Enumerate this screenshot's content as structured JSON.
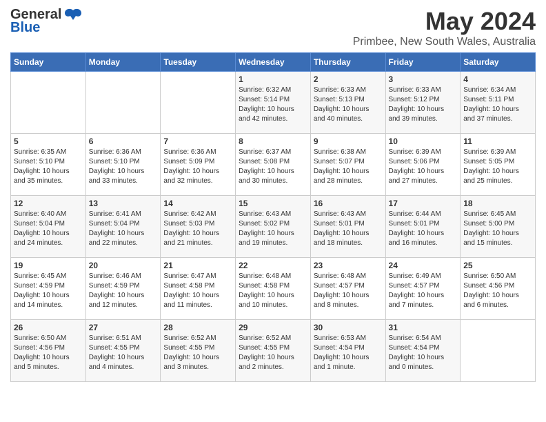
{
  "logo": {
    "general": "General",
    "blue": "Blue"
  },
  "title": "May 2024",
  "location": "Primbee, New South Wales, Australia",
  "days_of_week": [
    "Sunday",
    "Monday",
    "Tuesday",
    "Wednesday",
    "Thursday",
    "Friday",
    "Saturday"
  ],
  "weeks": [
    [
      {
        "day": "",
        "sunrise": "",
        "sunset": "",
        "daylight": ""
      },
      {
        "day": "",
        "sunrise": "",
        "sunset": "",
        "daylight": ""
      },
      {
        "day": "",
        "sunrise": "",
        "sunset": "",
        "daylight": ""
      },
      {
        "day": "1",
        "sunrise": "Sunrise: 6:32 AM",
        "sunset": "Sunset: 5:14 PM",
        "daylight": "Daylight: 10 hours and 42 minutes."
      },
      {
        "day": "2",
        "sunrise": "Sunrise: 6:33 AM",
        "sunset": "Sunset: 5:13 PM",
        "daylight": "Daylight: 10 hours and 40 minutes."
      },
      {
        "day": "3",
        "sunrise": "Sunrise: 6:33 AM",
        "sunset": "Sunset: 5:12 PM",
        "daylight": "Daylight: 10 hours and 39 minutes."
      },
      {
        "day": "4",
        "sunrise": "Sunrise: 6:34 AM",
        "sunset": "Sunset: 5:11 PM",
        "daylight": "Daylight: 10 hours and 37 minutes."
      }
    ],
    [
      {
        "day": "5",
        "sunrise": "Sunrise: 6:35 AM",
        "sunset": "Sunset: 5:10 PM",
        "daylight": "Daylight: 10 hours and 35 minutes."
      },
      {
        "day": "6",
        "sunrise": "Sunrise: 6:36 AM",
        "sunset": "Sunset: 5:10 PM",
        "daylight": "Daylight: 10 hours and 33 minutes."
      },
      {
        "day": "7",
        "sunrise": "Sunrise: 6:36 AM",
        "sunset": "Sunset: 5:09 PM",
        "daylight": "Daylight: 10 hours and 32 minutes."
      },
      {
        "day": "8",
        "sunrise": "Sunrise: 6:37 AM",
        "sunset": "Sunset: 5:08 PM",
        "daylight": "Daylight: 10 hours and 30 minutes."
      },
      {
        "day": "9",
        "sunrise": "Sunrise: 6:38 AM",
        "sunset": "Sunset: 5:07 PM",
        "daylight": "Daylight: 10 hours and 28 minutes."
      },
      {
        "day": "10",
        "sunrise": "Sunrise: 6:39 AM",
        "sunset": "Sunset: 5:06 PM",
        "daylight": "Daylight: 10 hours and 27 minutes."
      },
      {
        "day": "11",
        "sunrise": "Sunrise: 6:39 AM",
        "sunset": "Sunset: 5:05 PM",
        "daylight": "Daylight: 10 hours and 25 minutes."
      }
    ],
    [
      {
        "day": "12",
        "sunrise": "Sunrise: 6:40 AM",
        "sunset": "Sunset: 5:04 PM",
        "daylight": "Daylight: 10 hours and 24 minutes."
      },
      {
        "day": "13",
        "sunrise": "Sunrise: 6:41 AM",
        "sunset": "Sunset: 5:04 PM",
        "daylight": "Daylight: 10 hours and 22 minutes."
      },
      {
        "day": "14",
        "sunrise": "Sunrise: 6:42 AM",
        "sunset": "Sunset: 5:03 PM",
        "daylight": "Daylight: 10 hours and 21 minutes."
      },
      {
        "day": "15",
        "sunrise": "Sunrise: 6:43 AM",
        "sunset": "Sunset: 5:02 PM",
        "daylight": "Daylight: 10 hours and 19 minutes."
      },
      {
        "day": "16",
        "sunrise": "Sunrise: 6:43 AM",
        "sunset": "Sunset: 5:01 PM",
        "daylight": "Daylight: 10 hours and 18 minutes."
      },
      {
        "day": "17",
        "sunrise": "Sunrise: 6:44 AM",
        "sunset": "Sunset: 5:01 PM",
        "daylight": "Daylight: 10 hours and 16 minutes."
      },
      {
        "day": "18",
        "sunrise": "Sunrise: 6:45 AM",
        "sunset": "Sunset: 5:00 PM",
        "daylight": "Daylight: 10 hours and 15 minutes."
      }
    ],
    [
      {
        "day": "19",
        "sunrise": "Sunrise: 6:45 AM",
        "sunset": "Sunset: 4:59 PM",
        "daylight": "Daylight: 10 hours and 14 minutes."
      },
      {
        "day": "20",
        "sunrise": "Sunrise: 6:46 AM",
        "sunset": "Sunset: 4:59 PM",
        "daylight": "Daylight: 10 hours and 12 minutes."
      },
      {
        "day": "21",
        "sunrise": "Sunrise: 6:47 AM",
        "sunset": "Sunset: 4:58 PM",
        "daylight": "Daylight: 10 hours and 11 minutes."
      },
      {
        "day": "22",
        "sunrise": "Sunrise: 6:48 AM",
        "sunset": "Sunset: 4:58 PM",
        "daylight": "Daylight: 10 hours and 10 minutes."
      },
      {
        "day": "23",
        "sunrise": "Sunrise: 6:48 AM",
        "sunset": "Sunset: 4:57 PM",
        "daylight": "Daylight: 10 hours and 8 minutes."
      },
      {
        "day": "24",
        "sunrise": "Sunrise: 6:49 AM",
        "sunset": "Sunset: 4:57 PM",
        "daylight": "Daylight: 10 hours and 7 minutes."
      },
      {
        "day": "25",
        "sunrise": "Sunrise: 6:50 AM",
        "sunset": "Sunset: 4:56 PM",
        "daylight": "Daylight: 10 hours and 6 minutes."
      }
    ],
    [
      {
        "day": "26",
        "sunrise": "Sunrise: 6:50 AM",
        "sunset": "Sunset: 4:56 PM",
        "daylight": "Daylight: 10 hours and 5 minutes."
      },
      {
        "day": "27",
        "sunrise": "Sunrise: 6:51 AM",
        "sunset": "Sunset: 4:55 PM",
        "daylight": "Daylight: 10 hours and 4 minutes."
      },
      {
        "day": "28",
        "sunrise": "Sunrise: 6:52 AM",
        "sunset": "Sunset: 4:55 PM",
        "daylight": "Daylight: 10 hours and 3 minutes."
      },
      {
        "day": "29",
        "sunrise": "Sunrise: 6:52 AM",
        "sunset": "Sunset: 4:55 PM",
        "daylight": "Daylight: 10 hours and 2 minutes."
      },
      {
        "day": "30",
        "sunrise": "Sunrise: 6:53 AM",
        "sunset": "Sunset: 4:54 PM",
        "daylight": "Daylight: 10 hours and 1 minute."
      },
      {
        "day": "31",
        "sunrise": "Sunrise: 6:54 AM",
        "sunset": "Sunset: 4:54 PM",
        "daylight": "Daylight: 10 hours and 0 minutes."
      },
      {
        "day": "",
        "sunrise": "",
        "sunset": "",
        "daylight": ""
      }
    ]
  ]
}
